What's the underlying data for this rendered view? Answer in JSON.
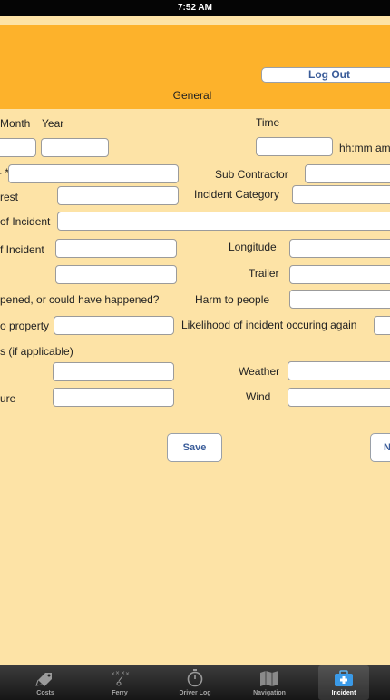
{
  "status_bar": {
    "time": "7:52 AM"
  },
  "header": {
    "logout_label": "Log Out",
    "section_title": "General"
  },
  "form": {
    "month_label": "Month",
    "year_label": "Year",
    "time_label": "Time",
    "time_format_hint": "hh:mm am",
    "row_required_label": "- *",
    "sub_contractor_label": "Sub Contractor",
    "rest_label": "rest",
    "incident_category_label": "Incident Category",
    "of_incident_label_1": "of Incident",
    "f_incident_label": "f Incident",
    "longitude_label": "Longitude",
    "trailer_label": "Trailer",
    "happened_label": "pened, or could have happened?",
    "harm_people_label": "Harm to people",
    "property_label": "o property",
    "likelihood_label": "Likelihood of incident occuring again",
    "applicable_label": "s (if applicable)",
    "weather_label": "Weather",
    "ure_label": "ure",
    "wind_label": "Wind"
  },
  "actions": {
    "save_label": "Save",
    "next_label": "N"
  },
  "tab_bar": {
    "tabs": [
      {
        "label": "Costs",
        "icon": "tag-icon"
      },
      {
        "label": "Ferry",
        "icon": "play-diagram-icon"
      },
      {
        "label": "Driver Log",
        "icon": "stopwatch-icon"
      },
      {
        "label": "Navigation",
        "icon": "map-icon"
      },
      {
        "label": "Incident",
        "icon": "first-aid-kit-icon"
      }
    ],
    "active_tab": "Incident"
  },
  "colors": {
    "header": "#fdb22b",
    "background": "#fde3a6",
    "button_text": "#3a5c99"
  }
}
